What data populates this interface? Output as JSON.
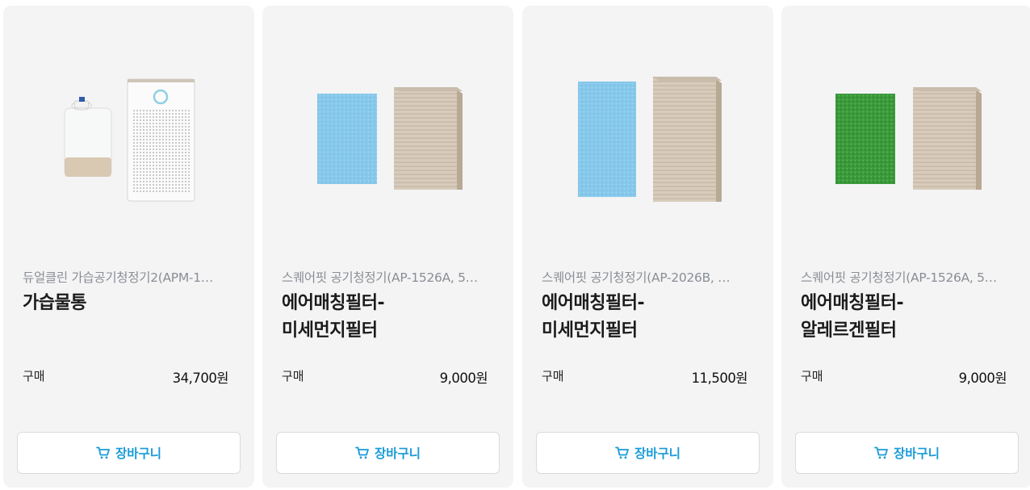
{
  "products": [
    {
      "subtitle": "듀얼클린 가습공기청정기2(APM-1…",
      "title": "가습물통",
      "price_label": "구매",
      "price": "34,700원",
      "cart_label": "장바구니",
      "filter_color": "",
      "image": "humidifier-tank-and-purifier"
    },
    {
      "subtitle": "스퀘어핏 공기청정기(AP-1526A, 5…",
      "title": "에어매칭필터-\n미세먼지필터",
      "price_label": "구매",
      "price": "9,000원",
      "cart_label": "장바구니",
      "filter_color": "#86c8ea",
      "image": "fine-dust-filter-and-purifier"
    },
    {
      "subtitle": "스퀘어핏 공기청정기(AP-2026B, …",
      "title": "에어매칭필터-\n미세먼지필터",
      "price_label": "구매",
      "price": "11,500원",
      "cart_label": "장바구니",
      "filter_color": "#86c8ea",
      "image": "fine-dust-filter-and-purifier-large"
    },
    {
      "subtitle": "스퀘어핏 공기청정기(AP-1526A, 5…",
      "title": "에어매칭필터-\n알레르겐필터",
      "price_label": "구매",
      "price": "9,000원",
      "cart_label": "장바구니",
      "filter_color": "#3a9a3a",
      "image": "allergen-filter-and-purifier"
    }
  ],
  "colors": {
    "card_bg": "#f4f4f5",
    "accent": "#1a9bd7",
    "purifier_body": "#d8cbbb",
    "subtitle": "#8a8e94"
  }
}
